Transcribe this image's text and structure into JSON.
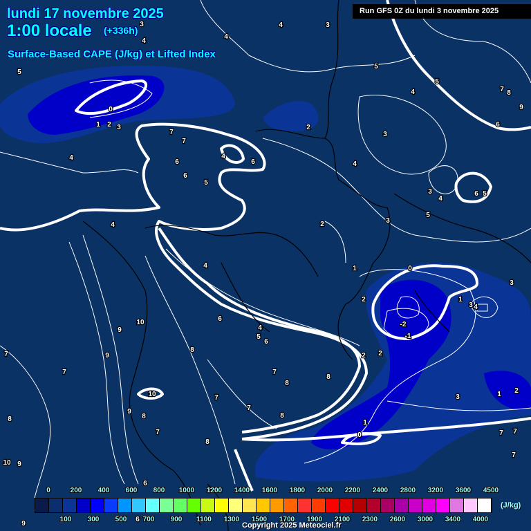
{
  "header": {
    "date": "lundi 17 novembre 2025",
    "time": "1:00 locale",
    "lead": "(+336h)",
    "parameter": "Surface-Based CAPE (J/kg) et Lifted Index",
    "run": "Run GFS 0Z du lundi 3 novembre 2025"
  },
  "colors": {
    "background": "#0a3264",
    "cape_100": "#0a3496",
    "cape_300": "#0000c8",
    "cape_400": "#0000ff",
    "contour": "#ffffff",
    "border": "#000000"
  },
  "colorbar": {
    "unit": "(J/kg)",
    "colors": [
      "#0a1a4a",
      "#0a2e6e",
      "#0a3496",
      "#0000c8",
      "#0000ff",
      "#0a3cff",
      "#0096ff",
      "#32c8ff",
      "#64ffff",
      "#78ff96",
      "#64ff64",
      "#64ff00",
      "#c8fa14",
      "#ffff00",
      "#ffff78",
      "#ffe650",
      "#ffc800",
      "#ff9b00",
      "#ff6400",
      "#ff3232",
      "#ff3c00",
      "#ff0000",
      "#e10000",
      "#b40000",
      "#b4002d",
      "#aa0064",
      "#aa00aa",
      "#c800c8",
      "#e100e1",
      "#ff00ff",
      "#e178e1",
      "#ffc8ff",
      "#ffffff"
    ],
    "top_labels": [
      "0",
      "200",
      "400",
      "600",
      "800",
      "1000",
      "1200",
      "1400",
      "1600",
      "1800",
      "2000",
      "2200",
      "2400",
      "2800",
      "3200",
      "3600",
      "4500"
    ],
    "bottom_labels": [
      "100",
      "300",
      "500",
      "700",
      "900",
      "1100",
      "1300",
      "1500",
      "1700",
      "1900",
      "2100",
      "2300",
      "2600",
      "3000",
      "3400",
      "4000"
    ]
  },
  "map_labels": [
    "0",
    "1",
    "2",
    "3",
    "4",
    "7",
    "7",
    "6",
    "6",
    "5",
    "4",
    "6",
    "4",
    "2",
    "3",
    "4",
    "3",
    "4",
    "4",
    "5",
    "5",
    "4",
    "7",
    "8",
    "9",
    "6",
    "3",
    "4",
    "6",
    "5",
    "5",
    "3",
    "2",
    "4",
    "1",
    "0",
    "2",
    "1",
    "3",
    "4",
    "3",
    "-2",
    "-1",
    "2",
    "2",
    "6",
    "4",
    "5",
    "6",
    "10",
    "9",
    "9",
    "8",
    "7",
    "7",
    "7",
    "8",
    "8",
    "10",
    "7",
    "7",
    "9",
    "8",
    "8",
    "7",
    "8",
    "8",
    "3",
    "1",
    "2",
    "1",
    "0",
    "7",
    "7",
    "7",
    "10",
    "9",
    "6",
    "9",
    "6",
    "7",
    "5",
    "3",
    "4"
  ],
  "copyright": "Copyright 2025 Meteociel.fr"
}
